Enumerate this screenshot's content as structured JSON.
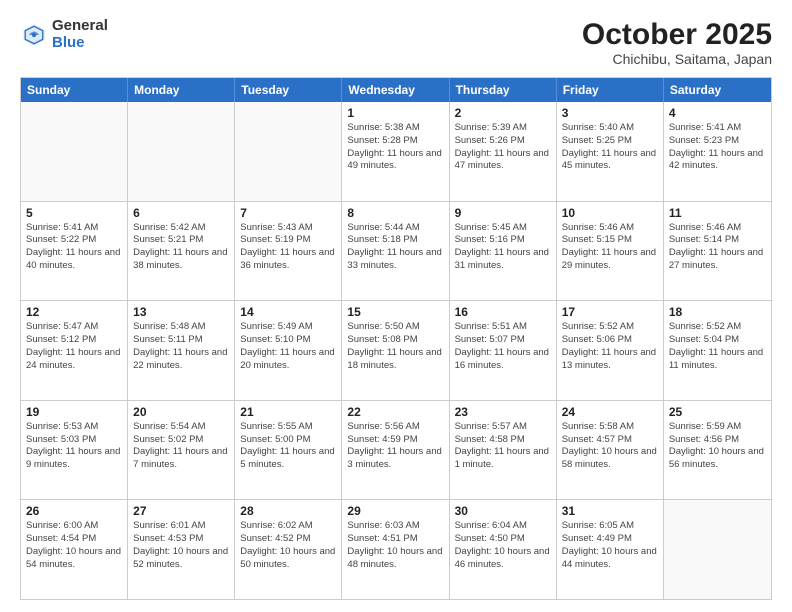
{
  "header": {
    "logo_general": "General",
    "logo_blue": "Blue",
    "month_title": "October 2025",
    "location": "Chichibu, Saitama, Japan"
  },
  "weekdays": [
    "Sunday",
    "Monday",
    "Tuesday",
    "Wednesday",
    "Thursday",
    "Friday",
    "Saturday"
  ],
  "rows": [
    [
      {
        "day": "",
        "info": ""
      },
      {
        "day": "",
        "info": ""
      },
      {
        "day": "",
        "info": ""
      },
      {
        "day": "1",
        "info": "Sunrise: 5:38 AM\nSunset: 5:28 PM\nDaylight: 11 hours\nand 49 minutes."
      },
      {
        "day": "2",
        "info": "Sunrise: 5:39 AM\nSunset: 5:26 PM\nDaylight: 11 hours\nand 47 minutes."
      },
      {
        "day": "3",
        "info": "Sunrise: 5:40 AM\nSunset: 5:25 PM\nDaylight: 11 hours\nand 45 minutes."
      },
      {
        "day": "4",
        "info": "Sunrise: 5:41 AM\nSunset: 5:23 PM\nDaylight: 11 hours\nand 42 minutes."
      }
    ],
    [
      {
        "day": "5",
        "info": "Sunrise: 5:41 AM\nSunset: 5:22 PM\nDaylight: 11 hours\nand 40 minutes."
      },
      {
        "day": "6",
        "info": "Sunrise: 5:42 AM\nSunset: 5:21 PM\nDaylight: 11 hours\nand 38 minutes."
      },
      {
        "day": "7",
        "info": "Sunrise: 5:43 AM\nSunset: 5:19 PM\nDaylight: 11 hours\nand 36 minutes."
      },
      {
        "day": "8",
        "info": "Sunrise: 5:44 AM\nSunset: 5:18 PM\nDaylight: 11 hours\nand 33 minutes."
      },
      {
        "day": "9",
        "info": "Sunrise: 5:45 AM\nSunset: 5:16 PM\nDaylight: 11 hours\nand 31 minutes."
      },
      {
        "day": "10",
        "info": "Sunrise: 5:46 AM\nSunset: 5:15 PM\nDaylight: 11 hours\nand 29 minutes."
      },
      {
        "day": "11",
        "info": "Sunrise: 5:46 AM\nSunset: 5:14 PM\nDaylight: 11 hours\nand 27 minutes."
      }
    ],
    [
      {
        "day": "12",
        "info": "Sunrise: 5:47 AM\nSunset: 5:12 PM\nDaylight: 11 hours\nand 24 minutes."
      },
      {
        "day": "13",
        "info": "Sunrise: 5:48 AM\nSunset: 5:11 PM\nDaylight: 11 hours\nand 22 minutes."
      },
      {
        "day": "14",
        "info": "Sunrise: 5:49 AM\nSunset: 5:10 PM\nDaylight: 11 hours\nand 20 minutes."
      },
      {
        "day": "15",
        "info": "Sunrise: 5:50 AM\nSunset: 5:08 PM\nDaylight: 11 hours\nand 18 minutes."
      },
      {
        "day": "16",
        "info": "Sunrise: 5:51 AM\nSunset: 5:07 PM\nDaylight: 11 hours\nand 16 minutes."
      },
      {
        "day": "17",
        "info": "Sunrise: 5:52 AM\nSunset: 5:06 PM\nDaylight: 11 hours\nand 13 minutes."
      },
      {
        "day": "18",
        "info": "Sunrise: 5:52 AM\nSunset: 5:04 PM\nDaylight: 11 hours\nand 11 minutes."
      }
    ],
    [
      {
        "day": "19",
        "info": "Sunrise: 5:53 AM\nSunset: 5:03 PM\nDaylight: 11 hours\nand 9 minutes."
      },
      {
        "day": "20",
        "info": "Sunrise: 5:54 AM\nSunset: 5:02 PM\nDaylight: 11 hours\nand 7 minutes."
      },
      {
        "day": "21",
        "info": "Sunrise: 5:55 AM\nSunset: 5:00 PM\nDaylight: 11 hours\nand 5 minutes."
      },
      {
        "day": "22",
        "info": "Sunrise: 5:56 AM\nSunset: 4:59 PM\nDaylight: 11 hours\nand 3 minutes."
      },
      {
        "day": "23",
        "info": "Sunrise: 5:57 AM\nSunset: 4:58 PM\nDaylight: 11 hours\nand 1 minute."
      },
      {
        "day": "24",
        "info": "Sunrise: 5:58 AM\nSunset: 4:57 PM\nDaylight: 10 hours\nand 58 minutes."
      },
      {
        "day": "25",
        "info": "Sunrise: 5:59 AM\nSunset: 4:56 PM\nDaylight: 10 hours\nand 56 minutes."
      }
    ],
    [
      {
        "day": "26",
        "info": "Sunrise: 6:00 AM\nSunset: 4:54 PM\nDaylight: 10 hours\nand 54 minutes."
      },
      {
        "day": "27",
        "info": "Sunrise: 6:01 AM\nSunset: 4:53 PM\nDaylight: 10 hours\nand 52 minutes."
      },
      {
        "day": "28",
        "info": "Sunrise: 6:02 AM\nSunset: 4:52 PM\nDaylight: 10 hours\nand 50 minutes."
      },
      {
        "day": "29",
        "info": "Sunrise: 6:03 AM\nSunset: 4:51 PM\nDaylight: 10 hours\nand 48 minutes."
      },
      {
        "day": "30",
        "info": "Sunrise: 6:04 AM\nSunset: 4:50 PM\nDaylight: 10 hours\nand 46 minutes."
      },
      {
        "day": "31",
        "info": "Sunrise: 6:05 AM\nSunset: 4:49 PM\nDaylight: 10 hours\nand 44 minutes."
      },
      {
        "day": "",
        "info": ""
      }
    ]
  ]
}
